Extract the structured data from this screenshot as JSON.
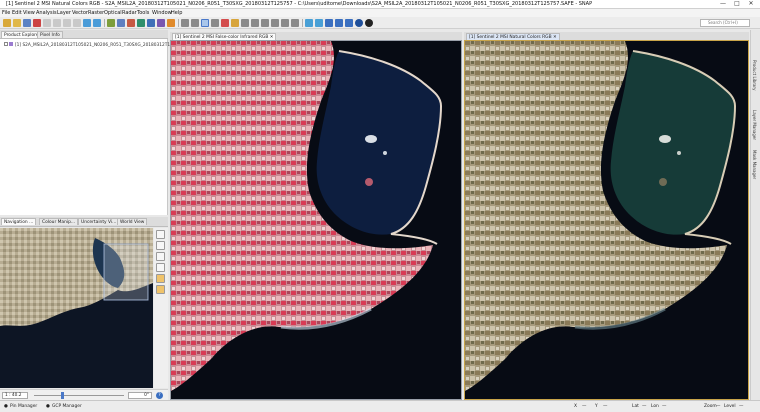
{
  "window": {
    "title": "[1] Sentinel 2 MSI Natural Colors RGB - S2A_MSIL2A_20180312T105021_N0206_R051_T30SXG_20180312T125757 - C:\\Users\\uditome\\Downloads\\S2A_MSIL2A_20180312T105021_N0206_R051_T30SXG_20180312T125757.SAFE - SNAP",
    "minimize": "—",
    "maximize": "□",
    "close": "✕"
  },
  "menu": [
    "File",
    "Edit",
    "View",
    "Analysis",
    "Layer",
    "Vector",
    "Raster",
    "Optical",
    "Radar",
    "Tools",
    "Window",
    "Help"
  ],
  "search": {
    "placeholder": "Search (Ctrl+I)"
  },
  "left_tabs": {
    "product_explorer": "Product Explorer",
    "pixel_info": "Pixel Info"
  },
  "tree": {
    "item": "[1] S2A_MSIL2A_20180312T105021_N0206_R051_T30SXG_20180312T12575"
  },
  "nav_tabs": {
    "navigation": "Navigation ...",
    "colour": "Colour Manip...",
    "uncertainty": "Uncertainty Vi...",
    "world": "World View"
  },
  "nav": {
    "zoom_value": "1 : 40.2",
    "rotation_value": "0°",
    "help": "?"
  },
  "views": {
    "view1_title": "[1] Sentinel 2 MSI False-color Infrared RGB",
    "view2_title": "[1] Sentinel 2 MSI Natural Colors RGB"
  },
  "right_panels": [
    "Product Library",
    "Layer Manager",
    "Mask Manager"
  ],
  "status": {
    "pin_manager": "Pin Manager",
    "gcp_manager": "GCP Manager",
    "x": "X",
    "y": "Y",
    "lat_label": "Lat",
    "lat_value": "—",
    "lon_label": "Lon",
    "zoom_label": "Zoom",
    "level_label": "Level",
    "dash": "—"
  }
}
